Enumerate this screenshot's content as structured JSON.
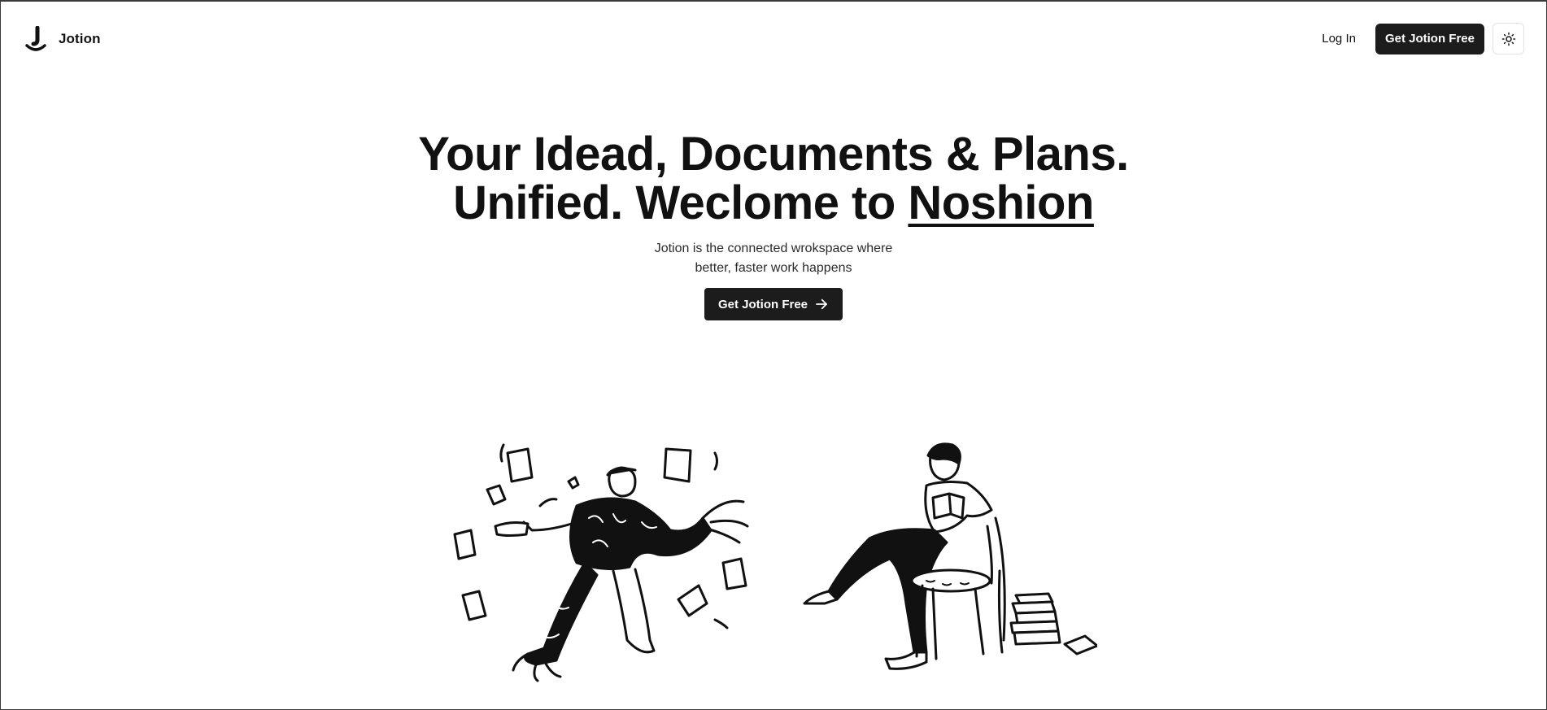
{
  "brand": {
    "name": "Jotion",
    "logo_icon": "jotion-logo-icon"
  },
  "nav": {
    "login_label": "Log In",
    "cta_label": "Get Jotion Free",
    "theme_icon": "sun-icon"
  },
  "hero": {
    "headline_part1": "Your Idead, Documents & Plans. Unified. Weclome to ",
    "headline_brand": "Noshion",
    "subhead": "Jotion is the connected wrokspace where better, faster work happens",
    "cta_label": "Get Jotion Free",
    "cta_icon": "arrow-right-icon"
  },
  "illustrations": {
    "left": "person-juggling-papers-illustration",
    "right": "person-reading-on-chair-illustration"
  },
  "colors": {
    "primary": "#1c1c1c",
    "background": "#ffffff",
    "text": "#111111"
  }
}
